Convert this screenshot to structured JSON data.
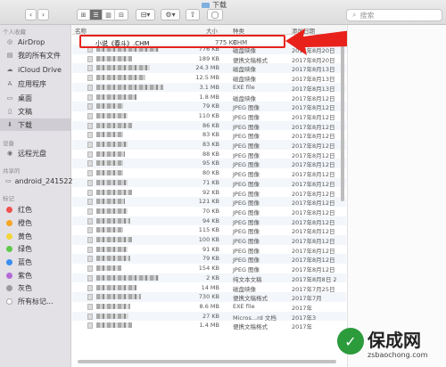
{
  "window": {
    "title": "下载"
  },
  "toolbar": {
    "search_placeholder": "搜索",
    "view_glyphs": [
      "⊞",
      "☰",
      "▥",
      "⊟"
    ],
    "back_glyph": "‹",
    "forward_glyph": "›",
    "group_glyph": "⊟▾",
    "action_glyph": "⚙▾",
    "share_glyph": "⇧",
    "tag_glyph": "◯"
  },
  "sidebar": {
    "favorites_header": "个人收藏",
    "favorites": [
      {
        "label": "AirDrop",
        "icon": "airdrop-icon",
        "glyph": "◎"
      },
      {
        "label": "我的所有文件",
        "icon": "all-files-icon",
        "glyph": "▤"
      },
      {
        "label": "iCloud Drive",
        "icon": "cloud-icon",
        "glyph": "☁"
      },
      {
        "label": "应用程序",
        "icon": "applications-icon",
        "glyph": "A"
      },
      {
        "label": "桌面",
        "icon": "desktop-icon",
        "glyph": "▭"
      },
      {
        "label": "文稿",
        "icon": "documents-icon",
        "glyph": "▯"
      },
      {
        "label": "下载",
        "icon": "downloads-icon",
        "glyph": "⬇",
        "selected": true
      }
    ],
    "devices_header": "设备",
    "devices": [
      {
        "label": "远程光盘",
        "icon": "disc-icon",
        "glyph": "◉"
      }
    ],
    "shared_header": "共享的",
    "shared": [
      {
        "label": "android_241522",
        "icon": "network-computer-icon",
        "glyph": "▭"
      }
    ],
    "tags_header": "标记",
    "tags": [
      {
        "label": "红色",
        "color": "#f0524f"
      },
      {
        "label": "橙色",
        "color": "#f5a623"
      },
      {
        "label": "黄色",
        "color": "#f3d33a"
      },
      {
        "label": "绿色",
        "color": "#5fc94a"
      },
      {
        "label": "蓝色",
        "color": "#3a8ff0"
      },
      {
        "label": "紫色",
        "color": "#b36ad8"
      },
      {
        "label": "灰色",
        "color": "#9b9b9b"
      },
      {
        "label": "所有标记...",
        "color": ""
      }
    ]
  },
  "columns": {
    "name": "名称",
    "size": "大小",
    "kind": "种类",
    "date": "添加日期"
  },
  "highlighted_file": {
    "name": "小说《春斗》.CHM",
    "size": "775 KB",
    "kind": "CHM"
  },
  "files": [
    {
      "size": "776 KB",
      "kind": "磁盘映像",
      "date": "2017年8月20日"
    },
    {
      "size": "189 KB",
      "kind": "便携文稿格式",
      "date": "2017年8月20日"
    },
    {
      "size": "24.3 MB",
      "kind": "磁盘映像",
      "date": "2017年8月13日"
    },
    {
      "size": "12.5 MB",
      "kind": "磁盘映像",
      "date": "2017年8月13日"
    },
    {
      "size": "3.1 MB",
      "kind": "EXE file",
      "date": "2017年8月13日"
    },
    {
      "size": "1.8 MB",
      "kind": "磁盘映像",
      "date": "2017年8月12日"
    },
    {
      "size": "79 KB",
      "kind": "JPEG 图像",
      "date": "2017年8月12日"
    },
    {
      "size": "110 KB",
      "kind": "JPEG 图像",
      "date": "2017年8月12日"
    },
    {
      "size": "86 KB",
      "kind": "JPEG 图像",
      "date": "2017年8月12日"
    },
    {
      "size": "83 KB",
      "kind": "JPEG 图像",
      "date": "2017年8月12日"
    },
    {
      "size": "83 KB",
      "kind": "JPEG 图像",
      "date": "2017年8月12日"
    },
    {
      "size": "88 KB",
      "kind": "JPEG 图像",
      "date": "2017年8月12日"
    },
    {
      "size": "95 KB",
      "kind": "JPEG 图像",
      "date": "2017年8月12日"
    },
    {
      "size": "80 KB",
      "kind": "JPEG 图像",
      "date": "2017年8月12日"
    },
    {
      "size": "71 KB",
      "kind": "JPEG 图像",
      "date": "2017年8月12日"
    },
    {
      "size": "92 KB",
      "kind": "JPEG 图像",
      "date": "2017年8月12日"
    },
    {
      "size": "121 KB",
      "kind": "JPEG 图像",
      "date": "2017年8月12日"
    },
    {
      "size": "70 KB",
      "kind": "JPEG 图像",
      "date": "2017年8月12日"
    },
    {
      "size": "94 KB",
      "kind": "JPEG 图像",
      "date": "2017年8月12日"
    },
    {
      "size": "115 KB",
      "kind": "JPEG 图像",
      "date": "2017年8月12日"
    },
    {
      "size": "100 KB",
      "kind": "JPEG 图像",
      "date": "2017年8月12日"
    },
    {
      "size": "91 KB",
      "kind": "JPEG 图像",
      "date": "2017年8月12日"
    },
    {
      "size": "79 KB",
      "kind": "JPEG 图像",
      "date": "2017年8月12日"
    },
    {
      "size": "154 KB",
      "kind": "JPEG 图像",
      "date": "2017年8月12日"
    },
    {
      "size": "2 KB",
      "kind": "纯文本文稿",
      "date": "2017年8月8日 2"
    },
    {
      "size": "14 MB",
      "kind": "磁盘映像",
      "date": "2017年7月25日"
    },
    {
      "size": "730 KB",
      "kind": "便携文稿格式",
      "date": "2017年7月"
    },
    {
      "size": "8.6 MB",
      "kind": "EXE file",
      "date": "2017年"
    },
    {
      "size": "27 KB",
      "kind": "Micros...rd 文档",
      "date": "2017年3"
    },
    {
      "size": "1.4 MB",
      "kind": "便携文稿格式",
      "date": "2017年"
    }
  ],
  "watermark": {
    "title": "保成网",
    "url": "zsbaochong.com"
  }
}
